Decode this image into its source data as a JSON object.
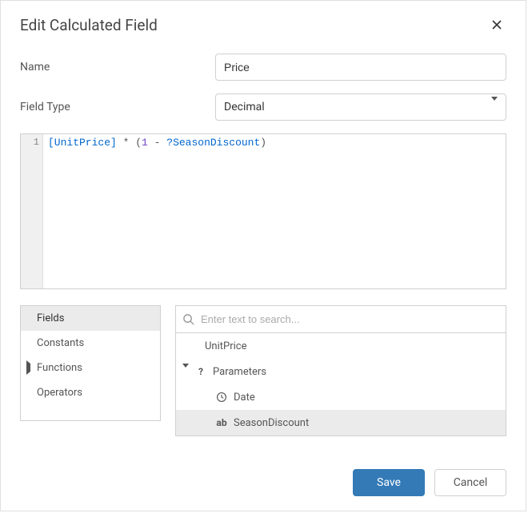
{
  "dialog": {
    "title": "Edit Calculated Field"
  },
  "form": {
    "name_label": "Name",
    "name_value": "Price",
    "type_label": "Field Type",
    "type_value": "Decimal"
  },
  "expression": {
    "line_number": "1",
    "tokens": {
      "t1": "[UnitPrice]",
      "t2": " * (",
      "t3": "1",
      "t4": " - ",
      "t5": "?SeasonDiscount",
      "t6": ")"
    }
  },
  "categories": {
    "items": [
      {
        "label": "Fields",
        "selected": true
      },
      {
        "label": "Constants"
      },
      {
        "label": "Functions",
        "expandable": true
      },
      {
        "label": "Operators"
      }
    ]
  },
  "search": {
    "placeholder": "Enter text to search..."
  },
  "fields_tree": {
    "items": [
      {
        "label": "UnitPrice",
        "kind": "field",
        "level": 1
      },
      {
        "label": "Parameters",
        "kind": "group",
        "icon": "?",
        "expanded": true,
        "level": 0
      },
      {
        "label": "Date",
        "kind": "param",
        "icon": "clock",
        "level": 2
      },
      {
        "label": "SeasonDiscount",
        "kind": "param",
        "icon": "ab",
        "level": 2,
        "selected": true
      }
    ]
  },
  "buttons": {
    "save": "Save",
    "cancel": "Cancel"
  }
}
